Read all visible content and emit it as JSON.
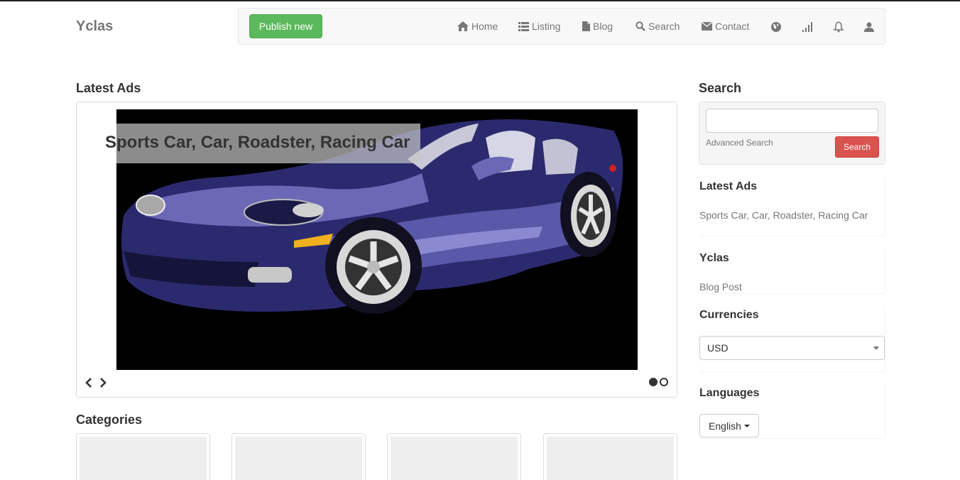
{
  "header": {
    "brand": "Yclas",
    "publish_label": "Publish new",
    "nav": {
      "home": "Home",
      "listing": "Listing",
      "blog": "Blog",
      "search": "Search",
      "contact": "Contact"
    },
    "icons": [
      "home-icon",
      "list-icon",
      "file-icon",
      "search-icon",
      "envelope-icon",
      "globe-icon",
      "signal-icon",
      "bell-icon",
      "user-icon"
    ]
  },
  "main": {
    "latest_ads_title": "Latest Ads",
    "carousel": {
      "caption": "Sports Car, Car, Roadster, Racing Car",
      "slide_count": 2,
      "active_slide": 1
    },
    "categories_title": "Categories"
  },
  "sidebar": {
    "search": {
      "title": "Search",
      "input_value": "",
      "advanced_link": "Advanced Search",
      "button_label": "Search"
    },
    "latest_ads": {
      "title": "Latest Ads",
      "items": [
        "Sports Car, Car, Roadster, Racing Car"
      ]
    },
    "blog": {
      "title": "Yclas",
      "items": [
        "Blog Post"
      ]
    },
    "currencies": {
      "title": "Currencies",
      "selected": "USD"
    },
    "languages": {
      "title": "Languages",
      "selected": "English"
    }
  },
  "colors": {
    "publish_button": "#5cb85c",
    "search_button": "#d9534f",
    "navbar_bg": "#f8f8f8",
    "car_body": "#2b2a6e",
    "slide_bg": "#000000"
  }
}
